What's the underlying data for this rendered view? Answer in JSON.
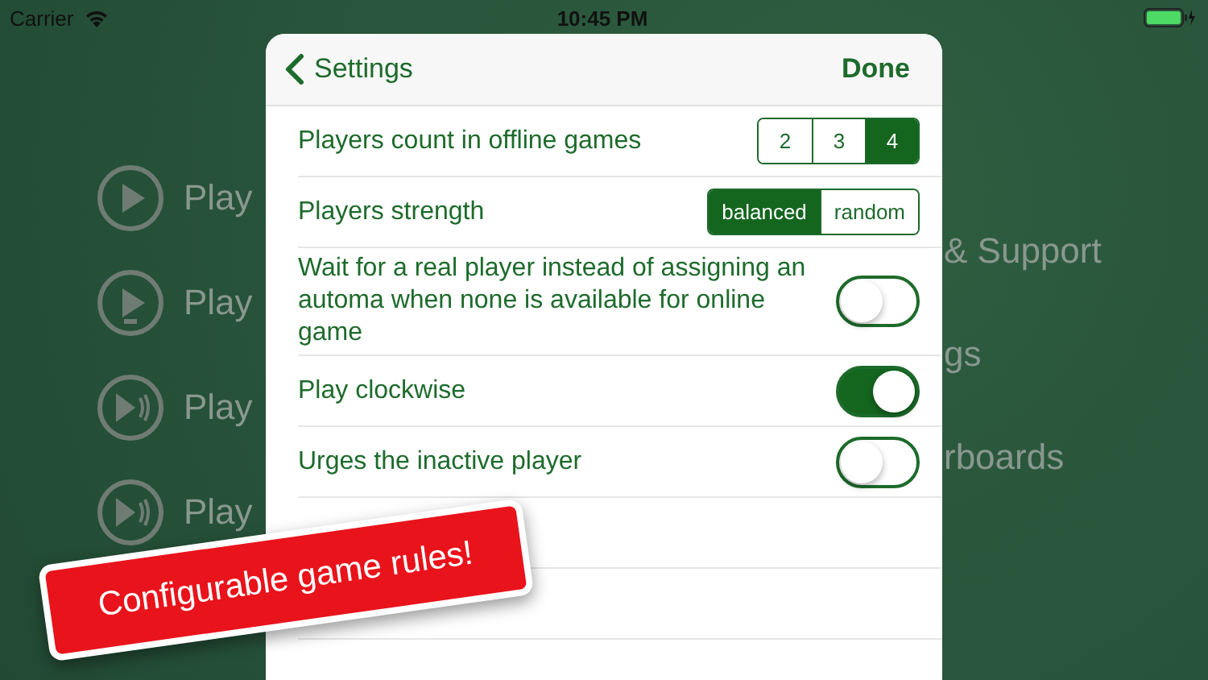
{
  "status_bar": {
    "carrier": "Carrier",
    "time": "10:45 PM"
  },
  "background_menu": {
    "left_items": [
      {
        "label": "Play",
        "kind": "play"
      },
      {
        "label": "Play",
        "kind": "play-badge"
      },
      {
        "label": "Play",
        "kind": "play-sound"
      },
      {
        "label": "Play",
        "kind": "play-sound"
      }
    ],
    "right_items": [
      "& Support",
      "gs",
      "rboards"
    ]
  },
  "settings": {
    "back_label": "Settings",
    "done_label": "Done",
    "rows": [
      {
        "kind": "segmented",
        "label": "Players count in offline games",
        "options": [
          {
            "label": "2",
            "selected": false
          },
          {
            "label": "3",
            "selected": false
          },
          {
            "label": "4",
            "selected": true
          }
        ]
      },
      {
        "kind": "segmented",
        "label": "Players strength",
        "options": [
          {
            "label": "balanced",
            "selected": true
          },
          {
            "label": "random",
            "selected": false
          }
        ]
      },
      {
        "kind": "toggle",
        "label": "Wait for a real player instead of assigning an automa when none is available for online game",
        "on": false
      },
      {
        "kind": "toggle",
        "label": "Play clockwise",
        "on": true
      },
      {
        "kind": "toggle",
        "label": "Urges the inactive player",
        "on": false
      },
      {
        "kind": "empty"
      },
      {
        "kind": "empty"
      }
    ]
  },
  "banner": {
    "text": "Configurable game rules!"
  }
}
